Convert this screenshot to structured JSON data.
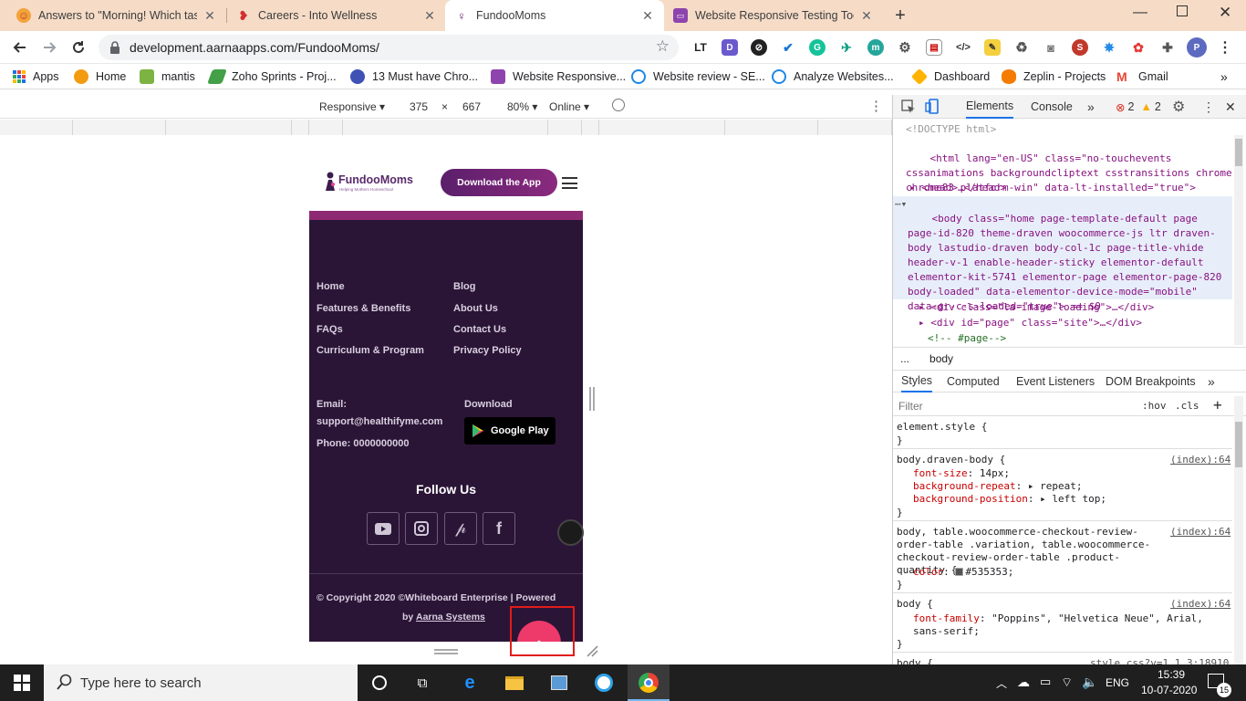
{
  "tabs": [
    {
      "title": "Answers to \"Morning! Which task",
      "active": false
    },
    {
      "title": "Careers - Into Wellness",
      "active": false
    },
    {
      "title": "FundooMoms",
      "active": true
    },
    {
      "title": "Website Responsive Testing Tool",
      "active": false
    }
  ],
  "address": {
    "url": "development.aarnaapps.com/FundooMoms/"
  },
  "bookmarks": [
    "Apps",
    "Home",
    "mantis",
    "Zoho Sprints - Proj...",
    "13 Must have Chro...",
    "Website Responsive...",
    "Website review - SE...",
    "Analyze Websites...",
    "Dashboard",
    "Zeplin - Projects",
    "Gmail"
  ],
  "device_toolbar": {
    "mode": "Responsive",
    "width": "375",
    "times": "×",
    "height": "667",
    "zoom": "80%",
    "network": "Online"
  },
  "site": {
    "logo_name": "FundooMoms",
    "logo_tagline": "Helping Mothers Homeschool",
    "download_button": "Download the App",
    "links_col1": [
      "Home",
      "Features & Benefits",
      "FAQs",
      "Curriculum & Program"
    ],
    "links_col2": [
      "Blog",
      "About Us",
      "Contact Us",
      "Privacy Policy"
    ],
    "email_label": "Email:",
    "email": "support@healthifyme.com",
    "phone": "Phone: 0000000000",
    "download_label": "Download",
    "google_play": "Google Play",
    "follow_us": "Follow Us",
    "copyright_line1": "© Copyright 2020 ©Whiteboard Enterprise | Powered",
    "copyright_by": "by",
    "copyright_link": "Aarna Systems"
  },
  "devtools": {
    "tabs": [
      "Elements",
      "Console"
    ],
    "errors": "2",
    "warnings": "2",
    "dom_lines": [
      "<!DOCTYPE html>",
      "<html lang=\"en-US\" class=\"no-touchevents cssanimations backgroundcliptext csstransitions chrome chrome83 platform-win\" data-lt-installed=\"true\">",
      "<head>…</head>",
      "<body class=\"home page-template-default page page-id-820 theme-draven woocommerce-js ltr draven-body lastudio-draven body-col-1c page-title-vhide header-v-1 enable-header-sticky elementor-default elementor-kit-5741 elementor-page elementor-page-820 body-loaded\" data-elementor-device-mode=\"mobile\" data-gr-c-s-loaded=\"true\"> == $0",
      "<div class=\"la-image-loading\">…</div>",
      "<div id=\"page\" class=\"site\">…</div>",
      "<!-- #page-->"
    ],
    "breadcrumb": [
      "...",
      "body"
    ],
    "style_tabs": [
      "Styles",
      "Computed",
      "Event Listeners",
      "DOM Breakpoints"
    ],
    "filter_placeholder": "Filter",
    "hov": ":hov",
    "cls": ".cls",
    "rules": [
      {
        "selector": "element.style {",
        "src": "",
        "props": []
      },
      {
        "selector": "body.draven-body {",
        "src": "(index):64",
        "props": [
          [
            "font-size",
            "14px;"
          ],
          [
            "background-repeat",
            "▸ repeat;"
          ],
          [
            "background-position",
            "▸ left top;"
          ]
        ]
      },
      {
        "selector": "body, table.woocommerce-checkout-review-order-table .variation, table.woocommerce-checkout-review-order-table .product-quantity {",
        "src": "(index):64",
        "props": [
          [
            "color",
            "#535353;"
          ]
        ]
      },
      {
        "selector": "body {",
        "src": "(index):64",
        "props": [
          [
            "font-family",
            "\"Poppins\", \"Helvetica Neue\", Arial, sans-serif;"
          ]
        ]
      },
      {
        "selector": "body {",
        "src": "style.css?v=1.1.3:18910",
        "props": []
      }
    ]
  },
  "taskbar": {
    "search_placeholder": "Type here to search",
    "time": "15:39",
    "date": "10-07-2020",
    "lang": "ENG",
    "notifications": "15"
  }
}
